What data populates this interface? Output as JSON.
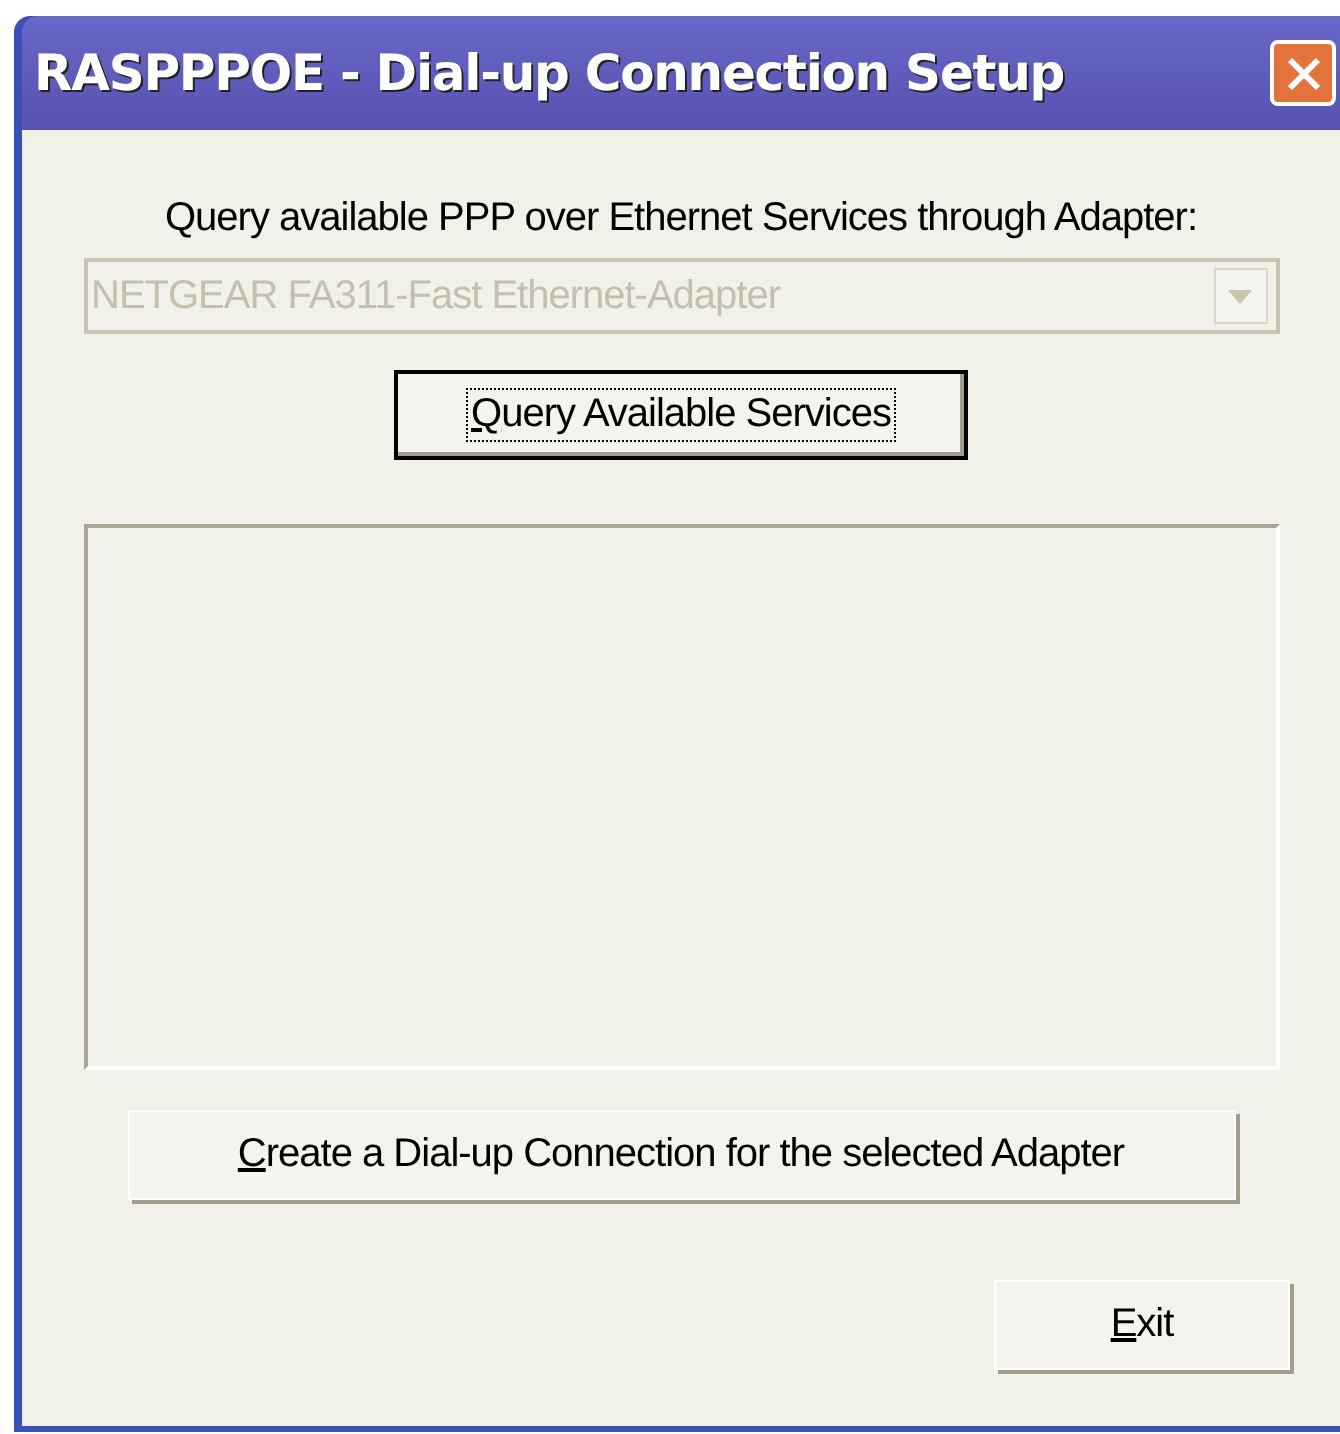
{
  "window": {
    "title": "RASPPPOE - Dial-up Connection Setup"
  },
  "adapter_label": "Query available PPP over Ethernet Services through Adapter:",
  "adapter_dropdown": {
    "value": "NETGEAR FA311-Fast Ethernet-Adapter",
    "disabled": true
  },
  "buttons": [
    {
      "kind": "query",
      "mnemonic": "Q",
      "rest": "uery Available Services",
      "focused": true
    },
    {
      "kind": "create",
      "mnemonic": "C",
      "rest": "reate a Dial-up Connection for the selected Adapter",
      "focused": false
    },
    {
      "kind": "exit",
      "mnemonic": "E",
      "rest": "xit",
      "focused": false
    }
  ]
}
